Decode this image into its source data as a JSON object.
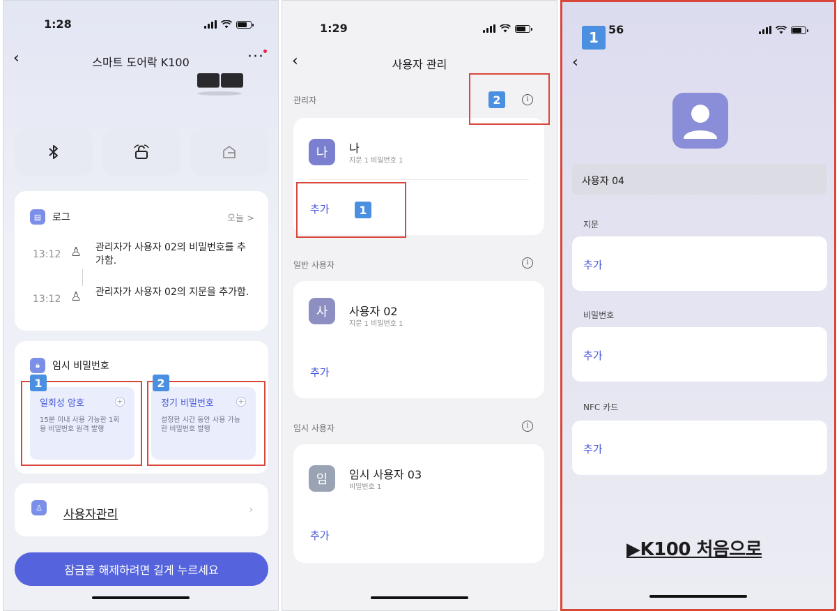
{
  "status_bar": {
    "time_1": "1:28",
    "time_2": "1:29",
    "time_3": "56"
  },
  "badges": {
    "one": "1",
    "two": "2"
  },
  "screen1": {
    "title": "스마트 도어락 K100",
    "more": "···",
    "quick_buttons": [
      {
        "icon": "bluetooth-icon",
        "glyph": "✱"
      },
      {
        "icon": "lock-icon",
        "glyph": "🔓"
      },
      {
        "icon": "home-icon",
        "glyph": "⌂"
      }
    ],
    "log": {
      "title": "로그",
      "today": "오늘 >",
      "entries": [
        {
          "time": "13:12",
          "text": "관리자가 사용자 02의 비밀번호를 추가함."
        },
        {
          "time": "13:12",
          "text": "관리자가 사용자 02의 지문을 추가함."
        }
      ]
    },
    "temp_password": {
      "title": "임시 비밀번호",
      "options": [
        {
          "title": "일회성 암호",
          "desc": "15분 이내 사용 가능한 1회용 비밀번호 원격 발행"
        },
        {
          "title": "정기 비밀번호",
          "desc": "설정한 시간 동안 사용 가능한 비밀번호 발행"
        }
      ]
    },
    "user_management": "사용자관리",
    "unlock_button": "잠금을 해제하려면 길게 누르세요"
  },
  "screen2": {
    "title": "사용자 관리",
    "sections": [
      {
        "label": "관리자",
        "user": {
          "initial": "나",
          "name": "나",
          "sub": "지문 1 비밀번호 1"
        },
        "add": "추가"
      },
      {
        "label": "일반 사용자",
        "user": {
          "initial": "사",
          "name": "사용자 02",
          "sub": "지문 1 비밀번호 1"
        },
        "add": "추가"
      },
      {
        "label": "임시 사용자",
        "user": {
          "initial": "임",
          "name": "임시 사용자 03",
          "sub": "비밀번호 1"
        },
        "add": "추가"
      }
    ]
  },
  "screen3": {
    "name": "사용자 04",
    "fields": [
      {
        "label": "지문",
        "add": "추가"
      },
      {
        "label": "비밀번호",
        "add": "추가"
      },
      {
        "label": "NFC 카드",
        "add": "추가"
      }
    ],
    "footer_link": "▶K100 처음으로"
  },
  "colors": {
    "accent": "#4758d9",
    "unlock": "#5563dd",
    "annotation_red": "#d9473b",
    "badge_blue": "#4a8fe0"
  }
}
